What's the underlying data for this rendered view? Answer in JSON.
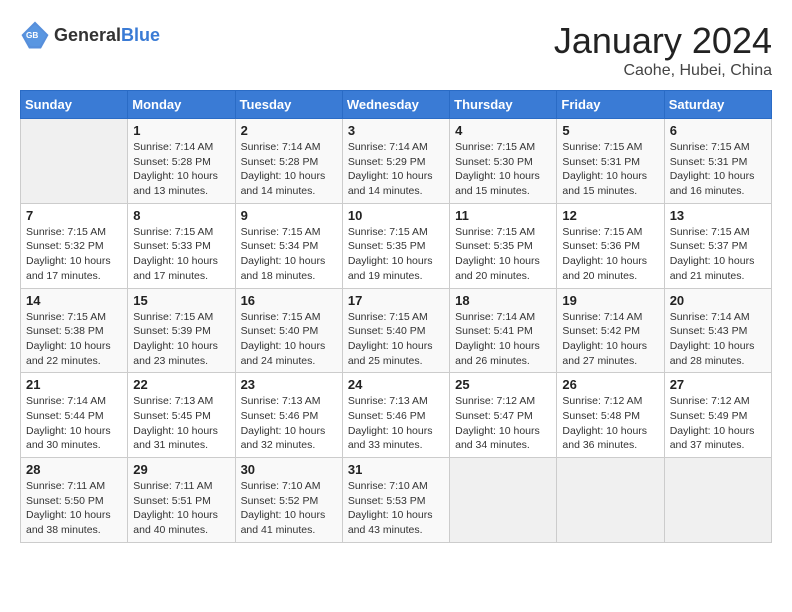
{
  "header": {
    "logo_general": "General",
    "logo_blue": "Blue",
    "month_year": "January 2024",
    "location": "Caohe, Hubei, China"
  },
  "days_of_week": [
    "Sunday",
    "Monday",
    "Tuesday",
    "Wednesday",
    "Thursday",
    "Friday",
    "Saturday"
  ],
  "weeks": [
    [
      {
        "day": "",
        "content": ""
      },
      {
        "day": "1",
        "content": "Sunrise: 7:14 AM\nSunset: 5:28 PM\nDaylight: 10 hours\nand 13 minutes."
      },
      {
        "day": "2",
        "content": "Sunrise: 7:14 AM\nSunset: 5:28 PM\nDaylight: 10 hours\nand 14 minutes."
      },
      {
        "day": "3",
        "content": "Sunrise: 7:14 AM\nSunset: 5:29 PM\nDaylight: 10 hours\nand 14 minutes."
      },
      {
        "day": "4",
        "content": "Sunrise: 7:15 AM\nSunset: 5:30 PM\nDaylight: 10 hours\nand 15 minutes."
      },
      {
        "day": "5",
        "content": "Sunrise: 7:15 AM\nSunset: 5:31 PM\nDaylight: 10 hours\nand 15 minutes."
      },
      {
        "day": "6",
        "content": "Sunrise: 7:15 AM\nSunset: 5:31 PM\nDaylight: 10 hours\nand 16 minutes."
      }
    ],
    [
      {
        "day": "7",
        "content": "Sunrise: 7:15 AM\nSunset: 5:32 PM\nDaylight: 10 hours\nand 17 minutes."
      },
      {
        "day": "8",
        "content": "Sunrise: 7:15 AM\nSunset: 5:33 PM\nDaylight: 10 hours\nand 17 minutes."
      },
      {
        "day": "9",
        "content": "Sunrise: 7:15 AM\nSunset: 5:34 PM\nDaylight: 10 hours\nand 18 minutes."
      },
      {
        "day": "10",
        "content": "Sunrise: 7:15 AM\nSunset: 5:35 PM\nDaylight: 10 hours\nand 19 minutes."
      },
      {
        "day": "11",
        "content": "Sunrise: 7:15 AM\nSunset: 5:35 PM\nDaylight: 10 hours\nand 20 minutes."
      },
      {
        "day": "12",
        "content": "Sunrise: 7:15 AM\nSunset: 5:36 PM\nDaylight: 10 hours\nand 20 minutes."
      },
      {
        "day": "13",
        "content": "Sunrise: 7:15 AM\nSunset: 5:37 PM\nDaylight: 10 hours\nand 21 minutes."
      }
    ],
    [
      {
        "day": "14",
        "content": "Sunrise: 7:15 AM\nSunset: 5:38 PM\nDaylight: 10 hours\nand 22 minutes."
      },
      {
        "day": "15",
        "content": "Sunrise: 7:15 AM\nSunset: 5:39 PM\nDaylight: 10 hours\nand 23 minutes."
      },
      {
        "day": "16",
        "content": "Sunrise: 7:15 AM\nSunset: 5:40 PM\nDaylight: 10 hours\nand 24 minutes."
      },
      {
        "day": "17",
        "content": "Sunrise: 7:15 AM\nSunset: 5:40 PM\nDaylight: 10 hours\nand 25 minutes."
      },
      {
        "day": "18",
        "content": "Sunrise: 7:14 AM\nSunset: 5:41 PM\nDaylight: 10 hours\nand 26 minutes."
      },
      {
        "day": "19",
        "content": "Sunrise: 7:14 AM\nSunset: 5:42 PM\nDaylight: 10 hours\nand 27 minutes."
      },
      {
        "day": "20",
        "content": "Sunrise: 7:14 AM\nSunset: 5:43 PM\nDaylight: 10 hours\nand 28 minutes."
      }
    ],
    [
      {
        "day": "21",
        "content": "Sunrise: 7:14 AM\nSunset: 5:44 PM\nDaylight: 10 hours\nand 30 minutes."
      },
      {
        "day": "22",
        "content": "Sunrise: 7:13 AM\nSunset: 5:45 PM\nDaylight: 10 hours\nand 31 minutes."
      },
      {
        "day": "23",
        "content": "Sunrise: 7:13 AM\nSunset: 5:46 PM\nDaylight: 10 hours\nand 32 minutes."
      },
      {
        "day": "24",
        "content": "Sunrise: 7:13 AM\nSunset: 5:46 PM\nDaylight: 10 hours\nand 33 minutes."
      },
      {
        "day": "25",
        "content": "Sunrise: 7:12 AM\nSunset: 5:47 PM\nDaylight: 10 hours\nand 34 minutes."
      },
      {
        "day": "26",
        "content": "Sunrise: 7:12 AM\nSunset: 5:48 PM\nDaylight: 10 hours\nand 36 minutes."
      },
      {
        "day": "27",
        "content": "Sunrise: 7:12 AM\nSunset: 5:49 PM\nDaylight: 10 hours\nand 37 minutes."
      }
    ],
    [
      {
        "day": "28",
        "content": "Sunrise: 7:11 AM\nSunset: 5:50 PM\nDaylight: 10 hours\nand 38 minutes."
      },
      {
        "day": "29",
        "content": "Sunrise: 7:11 AM\nSunset: 5:51 PM\nDaylight: 10 hours\nand 40 minutes."
      },
      {
        "day": "30",
        "content": "Sunrise: 7:10 AM\nSunset: 5:52 PM\nDaylight: 10 hours\nand 41 minutes."
      },
      {
        "day": "31",
        "content": "Sunrise: 7:10 AM\nSunset: 5:53 PM\nDaylight: 10 hours\nand 43 minutes."
      },
      {
        "day": "",
        "content": ""
      },
      {
        "day": "",
        "content": ""
      },
      {
        "day": "",
        "content": ""
      }
    ]
  ]
}
